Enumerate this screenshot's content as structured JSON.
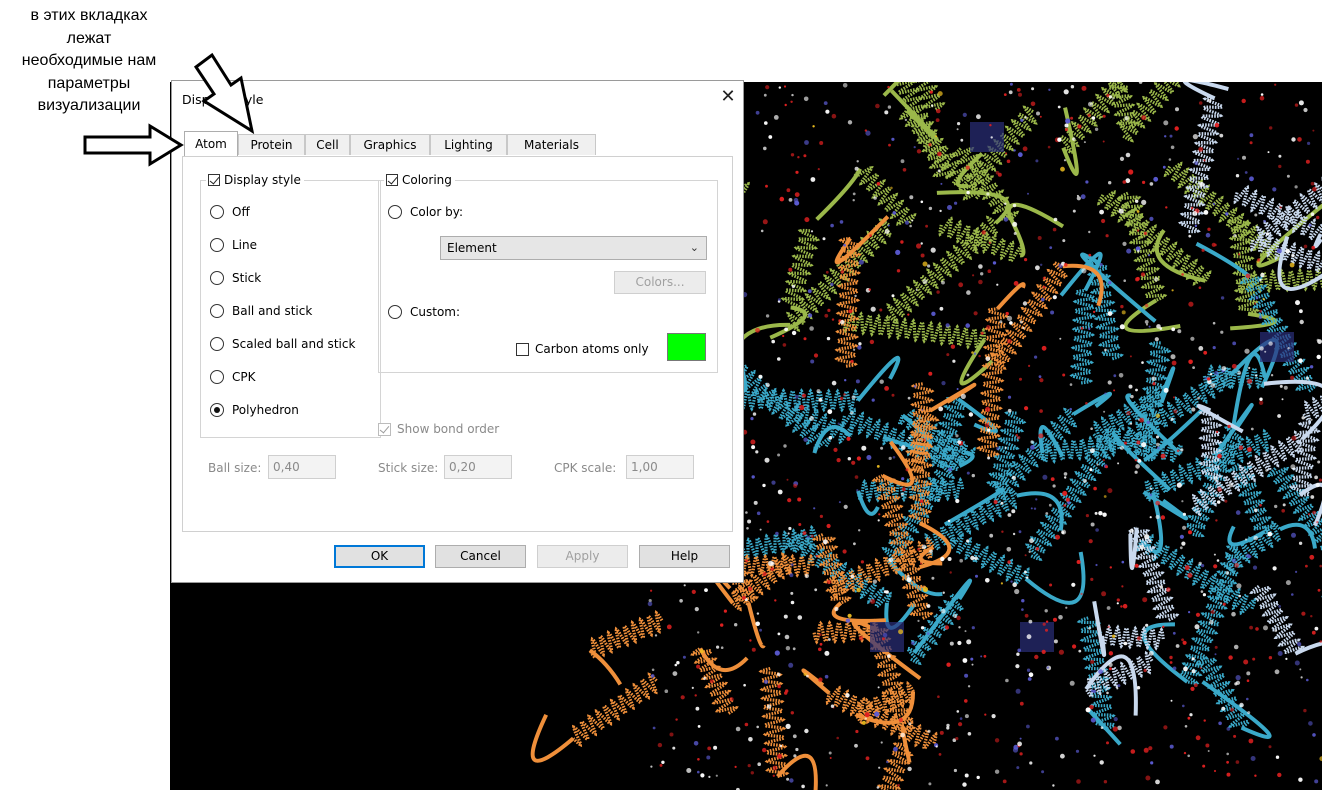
{
  "annotation": {
    "lines": [
      "в этих вкладках",
      "лежат",
      "необходимые нам",
      "параметры",
      "визуализации"
    ]
  },
  "dialog": {
    "title": "Display Style",
    "close_glyph": "✕",
    "tabs": [
      {
        "label": "Atom",
        "active": true
      },
      {
        "label": "Protein",
        "active": false
      },
      {
        "label": "Cell",
        "active": false
      },
      {
        "label": "Graphics",
        "active": false
      },
      {
        "label": "Lighting",
        "active": false
      },
      {
        "label": "Materials",
        "active": false
      }
    ],
    "display_style": {
      "label": "Display style",
      "checked": true,
      "options": [
        {
          "label": "Off",
          "selected": false
        },
        {
          "label": "Line",
          "selected": false
        },
        {
          "label": "Stick",
          "selected": false
        },
        {
          "label": "Ball and stick",
          "selected": false
        },
        {
          "label": "Scaled ball and stick",
          "selected": false
        },
        {
          "label": "CPK",
          "selected": false
        },
        {
          "label": "Polyhedron",
          "selected": true
        }
      ]
    },
    "coloring": {
      "label": "Coloring",
      "checked": true,
      "color_by_label": "Color by:",
      "color_by_value": "Element",
      "colors_button": "Colors...",
      "custom_label": "Custom:",
      "carbon_only_label": "Carbon atoms only",
      "carbon_only_checked": false,
      "custom_color": "#00ff00"
    },
    "show_bond_order": {
      "label": "Show bond order",
      "checked": true,
      "enabled": false
    },
    "ball_size": {
      "label": "Ball size:",
      "value": "0,40"
    },
    "stick_size": {
      "label": "Stick size:",
      "value": "0,20"
    },
    "cpk_scale": {
      "label": "CPK scale:",
      "value": "1,00"
    },
    "buttons": {
      "ok": "OK",
      "cancel": "Cancel",
      "apply": "Apply",
      "help": "Help"
    }
  },
  "viewer": {
    "background": "#000000",
    "ribbon_colors": [
      "#9bb84a",
      "#3aa9c9",
      "#ef8f3a",
      "#c9d9ee"
    ],
    "atom_colors": [
      "#e02020",
      "#ffffff",
      "#5a5ad0",
      "#f0c020"
    ]
  }
}
